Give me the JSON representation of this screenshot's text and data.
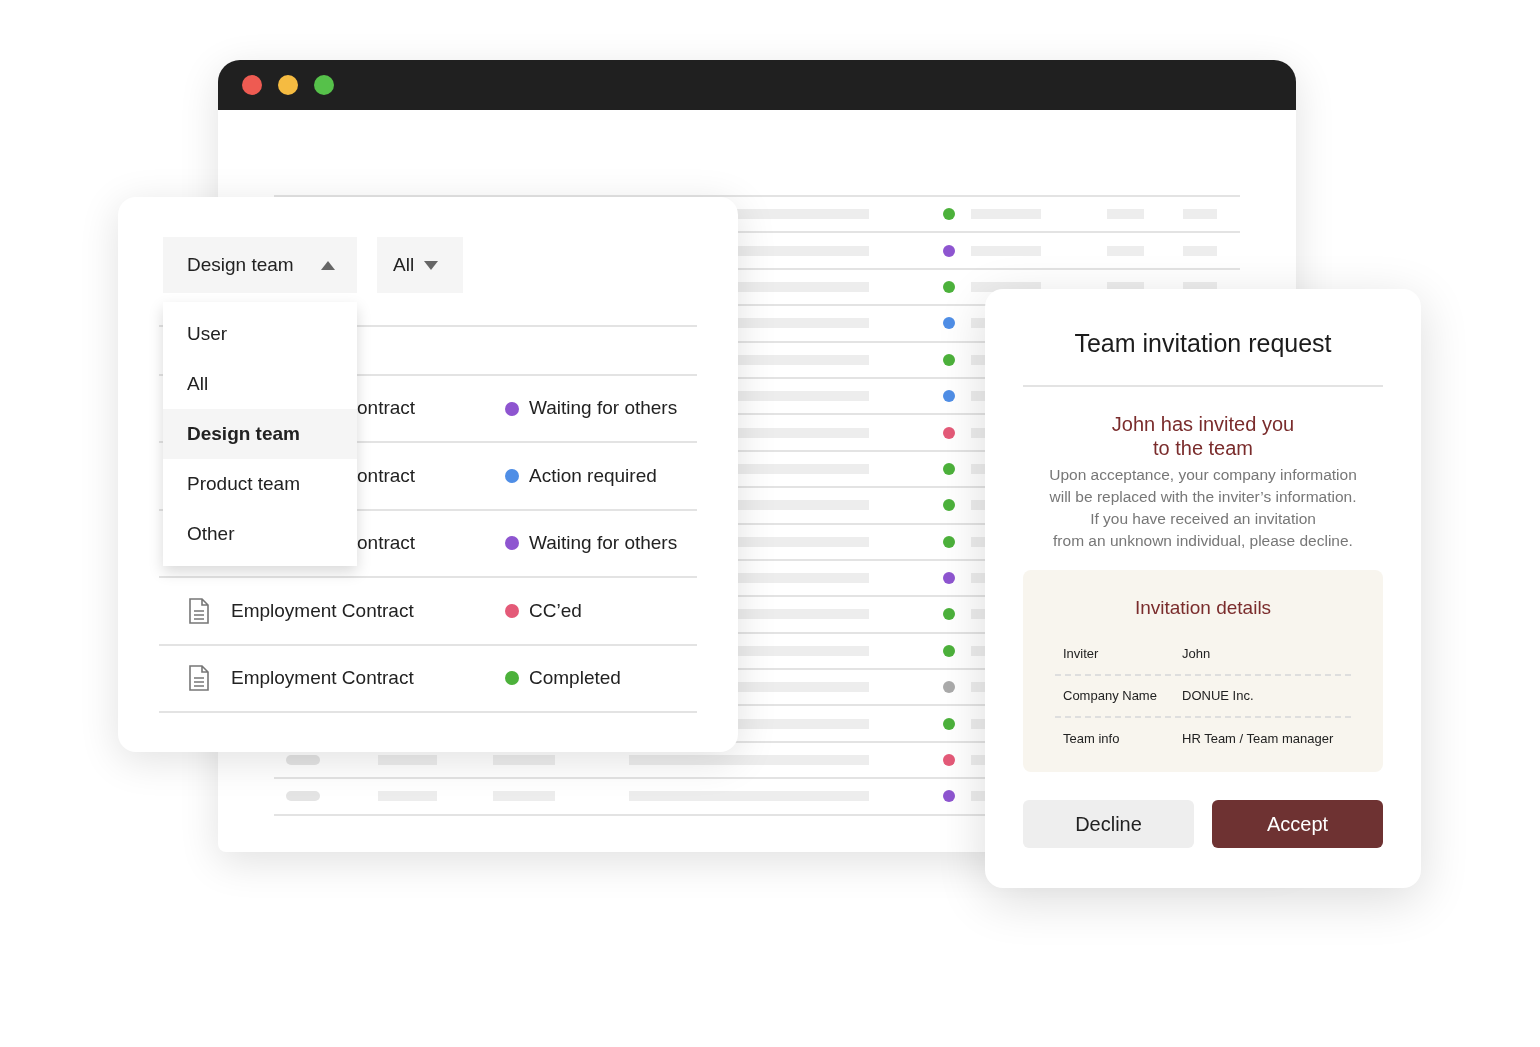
{
  "window": {
    "controls": [
      {
        "color": "#ee5b52"
      },
      {
        "color": "#f5bb41"
      },
      {
        "color": "#56c14a"
      }
    ]
  },
  "background_table": {
    "rows": [
      {
        "color": "#4cb13b"
      },
      {
        "color": "#8e55d0"
      },
      {
        "color": "#4cb13b"
      },
      {
        "color": "#4f8ee6"
      },
      {
        "color": "#4cb13b"
      },
      {
        "color": "#4f8ee6"
      },
      {
        "color": "#e45a78"
      },
      {
        "color": "#4cb13b"
      },
      {
        "color": "#4cb13b"
      },
      {
        "color": "#4cb13b"
      },
      {
        "color": "#8e55d0"
      },
      {
        "color": "#4cb13b"
      },
      {
        "color": "#4cb13b"
      },
      {
        "color": "#aaaaaa"
      },
      {
        "color": "#4cb13b"
      },
      {
        "color": "#e45a78"
      },
      {
        "color": "#8e55d0"
      }
    ]
  },
  "filter_panel": {
    "team_filter": {
      "label": "Design team",
      "expanded": true
    },
    "status_filter": {
      "label": "All",
      "expanded": false
    },
    "team_menu": [
      {
        "label": "User",
        "selected": false
      },
      {
        "label": "All",
        "selected": false
      },
      {
        "label": "Design team",
        "selected": true
      },
      {
        "label": "Product team",
        "selected": false
      },
      {
        "label": "Other",
        "selected": false
      }
    ],
    "documents": [
      {
        "name": "ontract",
        "covered": true,
        "status": "Waiting for others",
        "color": "#8e55d0"
      },
      {
        "name": "ontract",
        "covered": true,
        "status": "Action required",
        "color": "#4f8ee6"
      },
      {
        "name": "ontract",
        "covered": true,
        "status": "Waiting for others",
        "color": "#8e55d0"
      },
      {
        "name": "Employment Contract",
        "covered": false,
        "status": "CC’ed",
        "color": "#e45a78"
      },
      {
        "name": "Employment Contract",
        "covered": false,
        "status": "Completed",
        "color": "#4cb13b"
      }
    ]
  },
  "invitation": {
    "title": "Team invitation request",
    "heading": [
      "John has invited you",
      "to the team"
    ],
    "message": [
      "Upon acceptance, your company information",
      "will be replaced with the inviter’s information.",
      "If you have received an invitation",
      "from an unknown individual, please decline."
    ],
    "details_title": "Invitation details",
    "details": [
      {
        "label": "Inviter",
        "value": "John"
      },
      {
        "label": "Company Name",
        "value": "DONUE Inc."
      },
      {
        "label": "Team info",
        "value": "HR Team / Team manager"
      }
    ],
    "buttons": [
      {
        "label": "Decline",
        "kind": "secondary"
      },
      {
        "label": "Accept",
        "kind": "primary"
      }
    ]
  }
}
